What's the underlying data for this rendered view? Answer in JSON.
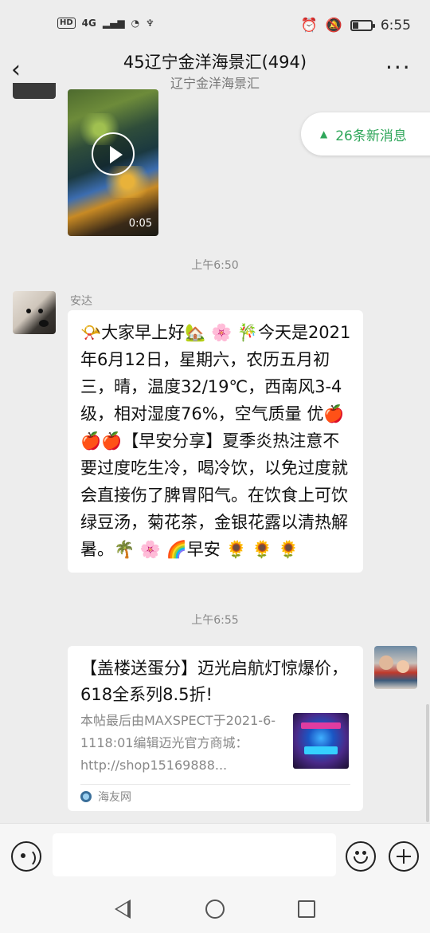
{
  "status_bar": {
    "hd": "HD",
    "network": "4G",
    "time": "6:55"
  },
  "header": {
    "title": "45辽宁金洋海景汇(494)",
    "subtitle": "辽宁金洋海景汇",
    "back_icon": "chevron-left-icon",
    "more_icon": "more-icon"
  },
  "new_messages": {
    "label": "26条新消息",
    "icon": "double-chevron-up-icon"
  },
  "messages": {
    "video": {
      "duration": "0:05"
    },
    "timestamp_1": "上午6:50",
    "text_message": {
      "sender": "安达",
      "content": "📯大家早上好🏡 🌸 🎋今天是2021年6月12日，星期六，农历五月初三，晴，温度32/19℃，西南风3-4级，相对湿度76%，空气质量 优🍎🍎🍎【早安分享】夏季炎热注意不要过度吃生冷，喝冷饮，以免过度就会直接伤了脾胃阳气。在饮食上可饮绿豆汤，菊花茶，金银花露以清热解暑。🌴 🌸 🌈早安 🌻 🌻 🌻"
    },
    "timestamp_2": "上午6:55",
    "link_card": {
      "title": "【盖楼送蛋分】迈光启航灯惊爆价，618全系列8.5折!",
      "description": "本帖最后由MAXSPECT于2021-6-1118:01编辑迈光官方商城：http://shop15169888...",
      "source": "海友网"
    }
  },
  "input_bar": {
    "placeholder": ""
  }
}
